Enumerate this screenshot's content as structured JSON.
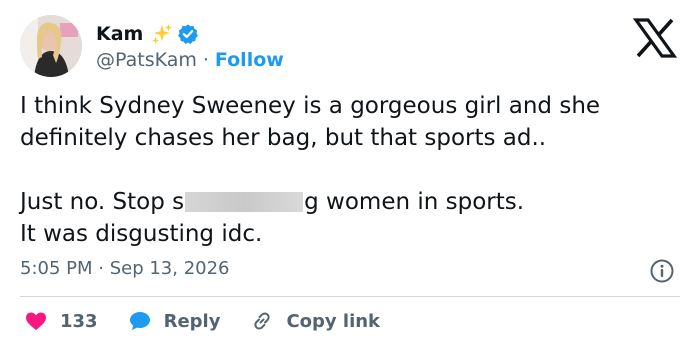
{
  "author": {
    "display_name": "Kam",
    "handle": "@PatsKam",
    "separator": "·",
    "follow_label": "Follow",
    "sparkle_icon": "sparkles-icon",
    "verified_icon": "verified-badge-icon"
  },
  "tweet": {
    "line1": "I think Sydney Sweeney is a gorgeous girl and she",
    "line2": "definitely chases her bag, but that sports ad..",
    "line3_before": "Just no. Stop s",
    "line3_after": "g women in sports.",
    "line4": "It was disgusting idc.",
    "timestamp": "5:05 PM · Sep 13, 2026"
  },
  "actions": {
    "likes_count": "133",
    "reply_label": "Reply",
    "copy_link_label": "Copy link"
  },
  "colors": {
    "accent": "#1d9bf0",
    "like": "#f91880",
    "secondary_text": "#536471",
    "sparkle": "#ffd43b"
  }
}
